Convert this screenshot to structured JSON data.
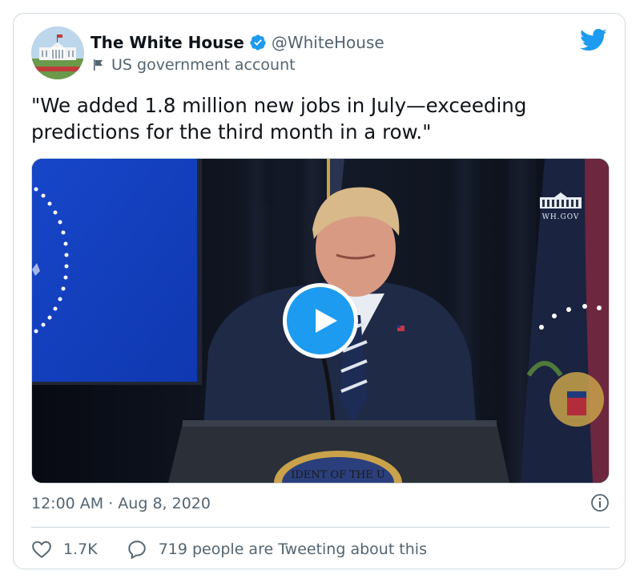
{
  "tweet": {
    "author": {
      "display_name": "The White House",
      "handle": "@WhiteHouse",
      "label": "US government account",
      "avatar_icon": "white-house-avatar",
      "verified_icon": "verified-badge-icon"
    },
    "brand_icon": "twitter-bird-icon",
    "text": "\"We added 1.8 million new jobs in July—exceeding predictions for the third month in a row.\"",
    "media": {
      "type": "video",
      "watermark": "WH.GOV",
      "podium_seal_text": "IDENT OF THE U",
      "play_icon": "play-icon"
    },
    "timestamp": "12:00 AM · Aug 8, 2020",
    "likes": "1.7K",
    "conversation": "719 people are Tweeting about this"
  },
  "colors": {
    "accent": "#1d9bf0",
    "secondary_text": "#536471",
    "border": "#cfd9de"
  }
}
